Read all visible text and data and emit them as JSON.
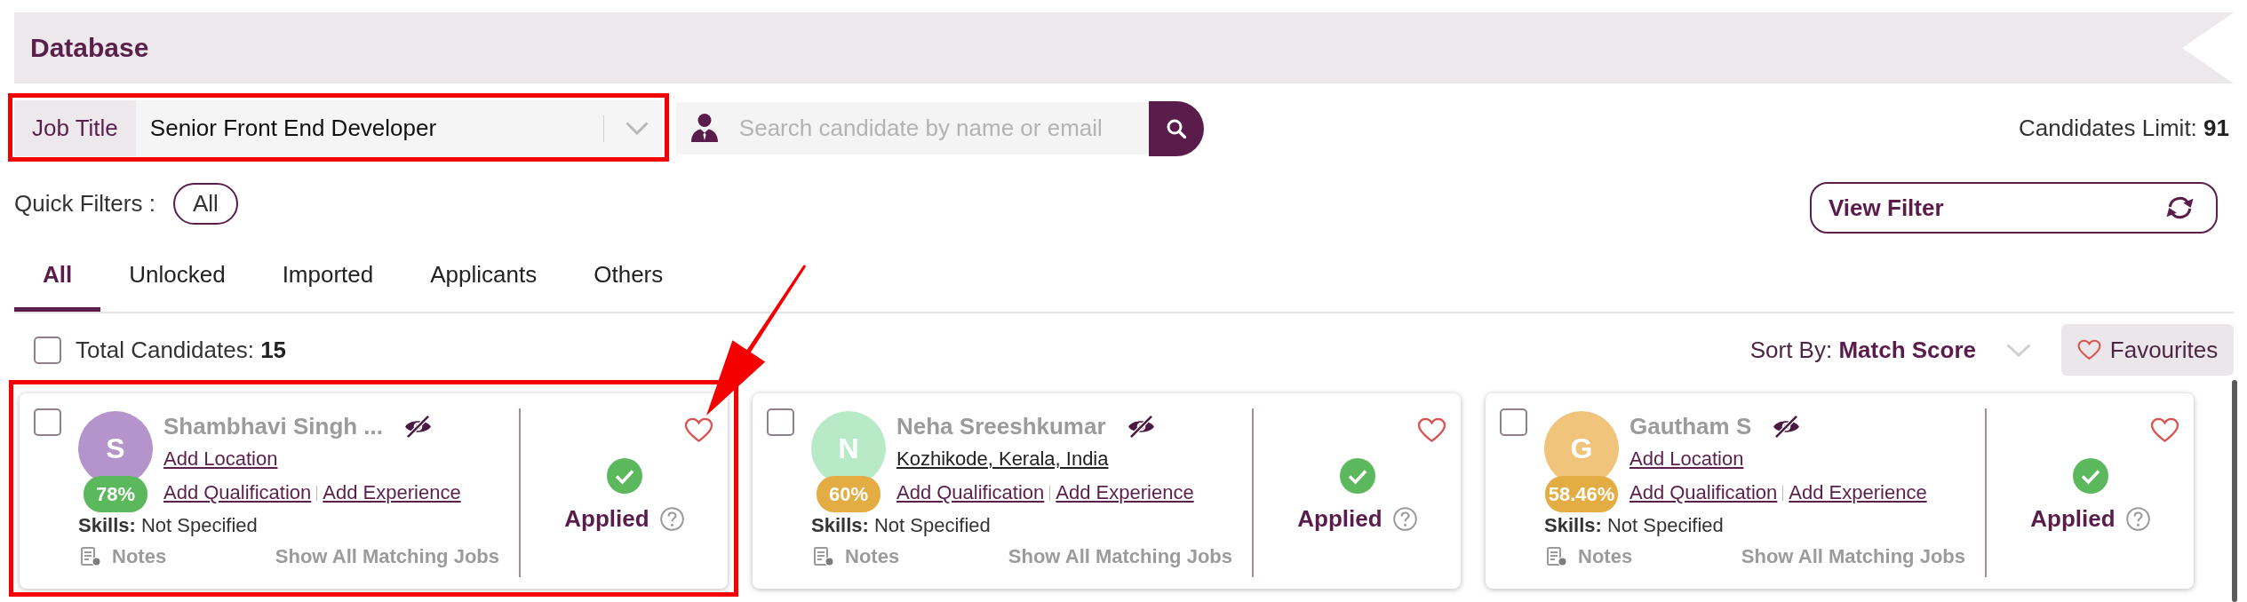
{
  "header": {
    "title": "Database"
  },
  "job_title": {
    "label": "Job Title",
    "value": "Senior Front End Developer"
  },
  "search": {
    "placeholder": "Search candidate by name or email"
  },
  "candidates_limit": "Candidates Limit: **91**",
  "quick_filters": {
    "label": "Quick Filters :",
    "chips": [
      {
        "label": "All"
      }
    ]
  },
  "view_filter": {
    "label": "View Filter"
  },
  "tabs": [
    {
      "label": "All",
      "selected": true
    },
    {
      "label": "Unlocked",
      "selected": false
    },
    {
      "label": "Imported",
      "selected": false
    },
    {
      "label": "Applicants",
      "selected": false
    },
    {
      "label": "Others",
      "selected": false
    }
  ],
  "total_candidates": {
    "text": "Total Candidates: **15**",
    "checked": false
  },
  "sort": {
    "text": "Sort By: **Match Score**"
  },
  "favourites": {
    "label": "Favourites"
  },
  "candidates": [
    {
      "checked": false,
      "avatar": {
        "initial": "S",
        "color": "#b594cc"
      },
      "score": {
        "text": "78%",
        "color": "#5cb85c"
      },
      "name": "Shambhavi Singh ...",
      "location": {
        "kind": "add",
        "text": "Add Location"
      },
      "links": [
        "Add Qualification",
        "Add Experience"
      ],
      "skills": "**Skills:** Not Specified",
      "notes": "Notes",
      "matching_jobs": "Show All Matching Jobs",
      "status": "Applied",
      "favourite": false
    },
    {
      "checked": false,
      "avatar": {
        "initial": "N",
        "color": "#b8eac8"
      },
      "score": {
        "text": "60%",
        "color": "#e3ad43"
      },
      "name": "Neha Sreeshkumar",
      "location": {
        "kind": "value",
        "text": "Kozhikode, Kerala, India"
      },
      "links": [
        "Add Qualification",
        "Add Experience"
      ],
      "skills": "**Skills:** Not Specified",
      "notes": "Notes",
      "matching_jobs": "Show All Matching Jobs",
      "status": "Applied",
      "favourite": false
    },
    {
      "checked": false,
      "avatar": {
        "initial": "G",
        "color": "#f1c47c"
      },
      "score": {
        "text": "58.46%",
        "color": "#e3ad43"
      },
      "name": "Gautham S",
      "location": {
        "kind": "add",
        "text": "Add Location"
      },
      "links": [
        "Add Qualification",
        "Add Experience"
      ],
      "skills": "**Skills:** Not Specified",
      "notes": "Notes",
      "matching_jobs": "Show All Matching Jobs",
      "status": "Applied",
      "favourite": false
    }
  ]
}
